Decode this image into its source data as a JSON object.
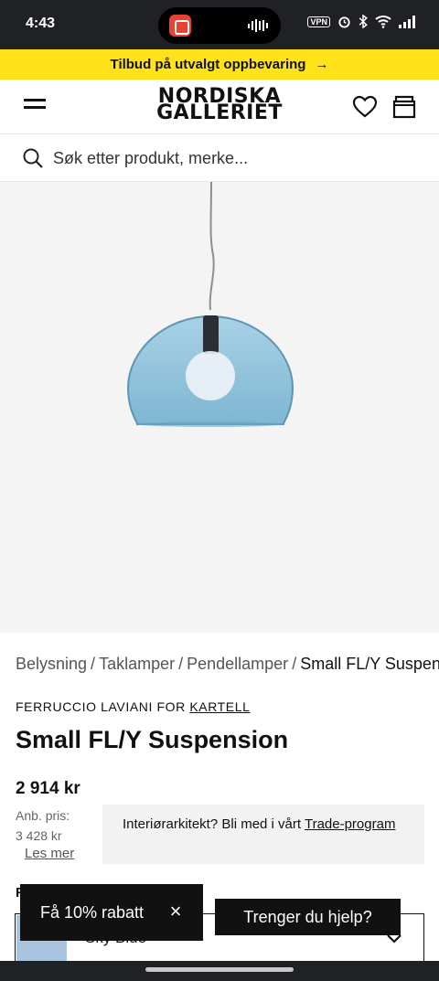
{
  "status_bar": {
    "time": "4:43",
    "vpn": "VPN"
  },
  "promo": {
    "text": "Tilbud på utvalgt oppbevaring",
    "arrow": "→"
  },
  "header": {
    "logo_line1": "NORDISKA",
    "logo_line2": "GALLERIET",
    "icons": [
      "menu-icon",
      "heart-icon",
      "cart-icon"
    ]
  },
  "search": {
    "placeholder": "Søk etter produkt, merke..."
  },
  "breadcrumb": {
    "items": [
      "Belysning",
      "Taklamper",
      "Pendellamper"
    ],
    "current": "Small FL/Y Suspension",
    "separator": "/"
  },
  "product": {
    "designer": "FERRUCCIO LAVIANI FOR",
    "brand": "KARTELL",
    "title": "Small FL/Y Suspension",
    "price": "2 914 kr",
    "old_price_label": "Anb. pris:",
    "old_price": "3 428 kr",
    "read_more": "Les mer"
  },
  "trade": {
    "text": "Interiørarkitekt? Bli med i vårt",
    "link": "Trade-program"
  },
  "variant": {
    "label": "F",
    "selected": "Sky Blue",
    "swatch_color": "#a8c4e0"
  },
  "popups": {
    "discount": "Få 10% rabatt",
    "close": "×",
    "help": "Trenger du hjelp?"
  },
  "colors": {
    "promo_bg": "#ffe21a",
    "lamp_blue": "#8fc3dc"
  }
}
